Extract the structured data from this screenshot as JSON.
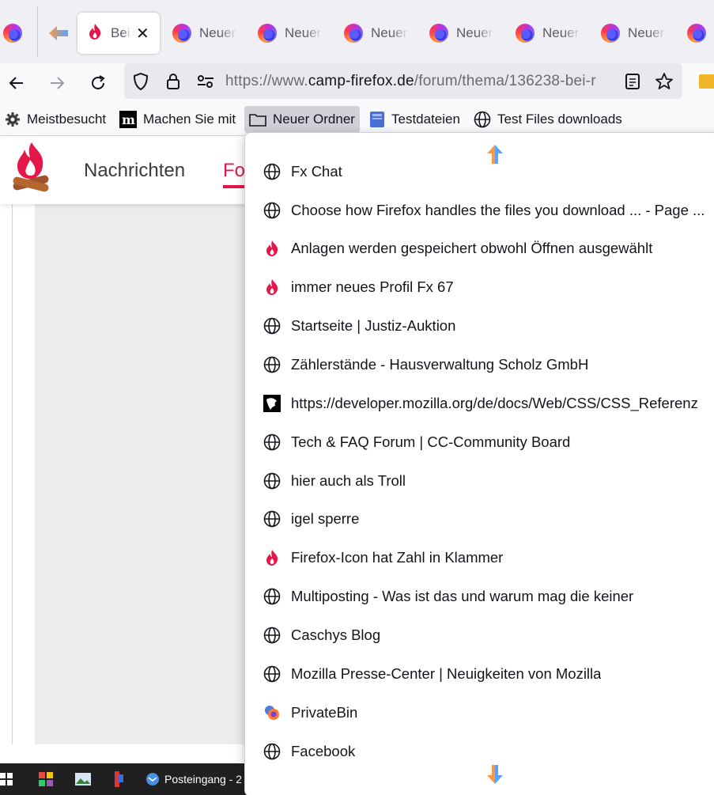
{
  "tabs": {
    "active_label": "Bei",
    "inactive": [
      {
        "label": "Neuer"
      },
      {
        "label": "Neuer"
      },
      {
        "label": "Neuer"
      },
      {
        "label": "Neuer"
      },
      {
        "label": "Neuer"
      },
      {
        "label": "Neuer"
      },
      {
        "label": ""
      }
    ]
  },
  "urlbar": {
    "prefix": "https://www.",
    "domain": "camp-firefox.de",
    "path": "/forum/thema/136238-bei-r"
  },
  "bookmarks": {
    "items": [
      {
        "label": "Meistbesucht",
        "icon": "gear-icon"
      },
      {
        "label": "Machen Sie mit",
        "icon": "mozilla-m-icon"
      },
      {
        "label": "Neuer Ordner",
        "icon": "folder-icon"
      },
      {
        "label": "Testdateien",
        "icon": "file-icon"
      },
      {
        "label": "Test Files downloads",
        "icon": "globe-icon"
      }
    ]
  },
  "site": {
    "nav_news": "Nachrichten",
    "nav_forum": "Fo"
  },
  "menu": {
    "items": [
      {
        "label": "Fx Chat",
        "icon": "globe-icon"
      },
      {
        "label": "Choose how Firefox handles the files you download ... - Page ...",
        "icon": "globe-icon"
      },
      {
        "label": "Anlagen werden gespeichert obwohl Öffnen ausgewählt",
        "icon": "flame-icon"
      },
      {
        "label": "immer neues Profil Fx 67",
        "icon": "flame-icon"
      },
      {
        "label": "Startseite | Justiz-Auktion",
        "icon": "globe-icon"
      },
      {
        "label": "Zählerstände - Hausverwaltung Scholz GmbH",
        "icon": "globe-icon"
      },
      {
        "label": "https://developer.mozilla.org/de/docs/Web/CSS/CSS_Referenz",
        "icon": "mdn-icon"
      },
      {
        "label": "Tech & FAQ Forum | CC-Community Board",
        "icon": "globe-icon"
      },
      {
        "label": "hier auch als Troll",
        "icon": "globe-icon"
      },
      {
        "label": "igel sperre",
        "icon": "globe-icon"
      },
      {
        "label": "Firefox-Icon hat Zahl in Klammer",
        "icon": "flame-icon"
      },
      {
        "label": "Multiposting - Was ist das und warum mag die keiner",
        "icon": "globe-icon"
      },
      {
        "label": "Caschys Blog",
        "icon": "globe-icon"
      },
      {
        "label": "Mozilla Presse-Center | Neuigkeiten von Mozilla",
        "icon": "globe-icon"
      },
      {
        "label": "PrivateBin",
        "icon": "privatebin-icon"
      },
      {
        "label": "Facebook",
        "icon": "globe-icon"
      }
    ]
  },
  "taskbar": {
    "mail_label": "Posteingang - 2"
  }
}
